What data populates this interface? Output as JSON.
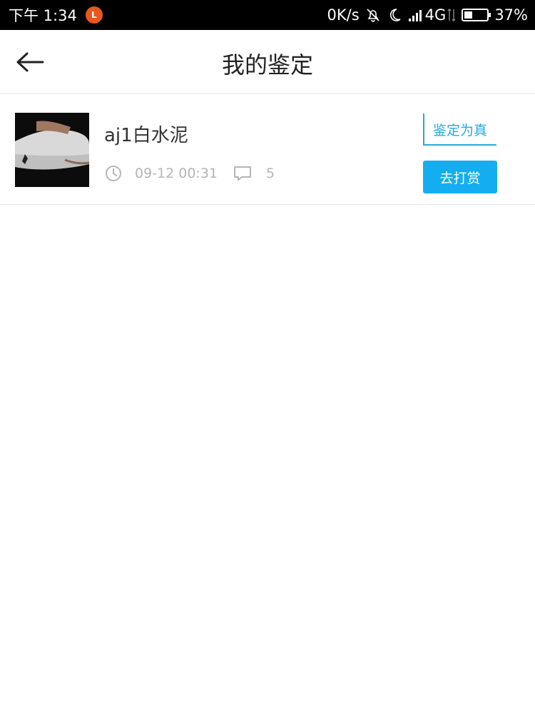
{
  "status_bar": {
    "time": "下午 1:34",
    "app_badge": "L",
    "network_speed": "0K/s",
    "signal_type": "4G",
    "battery_percent": "37%",
    "battery_level": 0.37
  },
  "header": {
    "title": "我的鉴定",
    "back_icon": "arrow-left-icon"
  },
  "items": [
    {
      "title": "aj1白水泥",
      "time": "09-12 00:31",
      "comment_count": "5",
      "verdict_label": "鉴定为真",
      "reward_label": "去打赏"
    }
  ],
  "colors": {
    "accent": "#14aef0",
    "verdict_text": "#27a9e1",
    "meta_gray": "#b5b5b5",
    "divider": "#e6e6e6"
  }
}
